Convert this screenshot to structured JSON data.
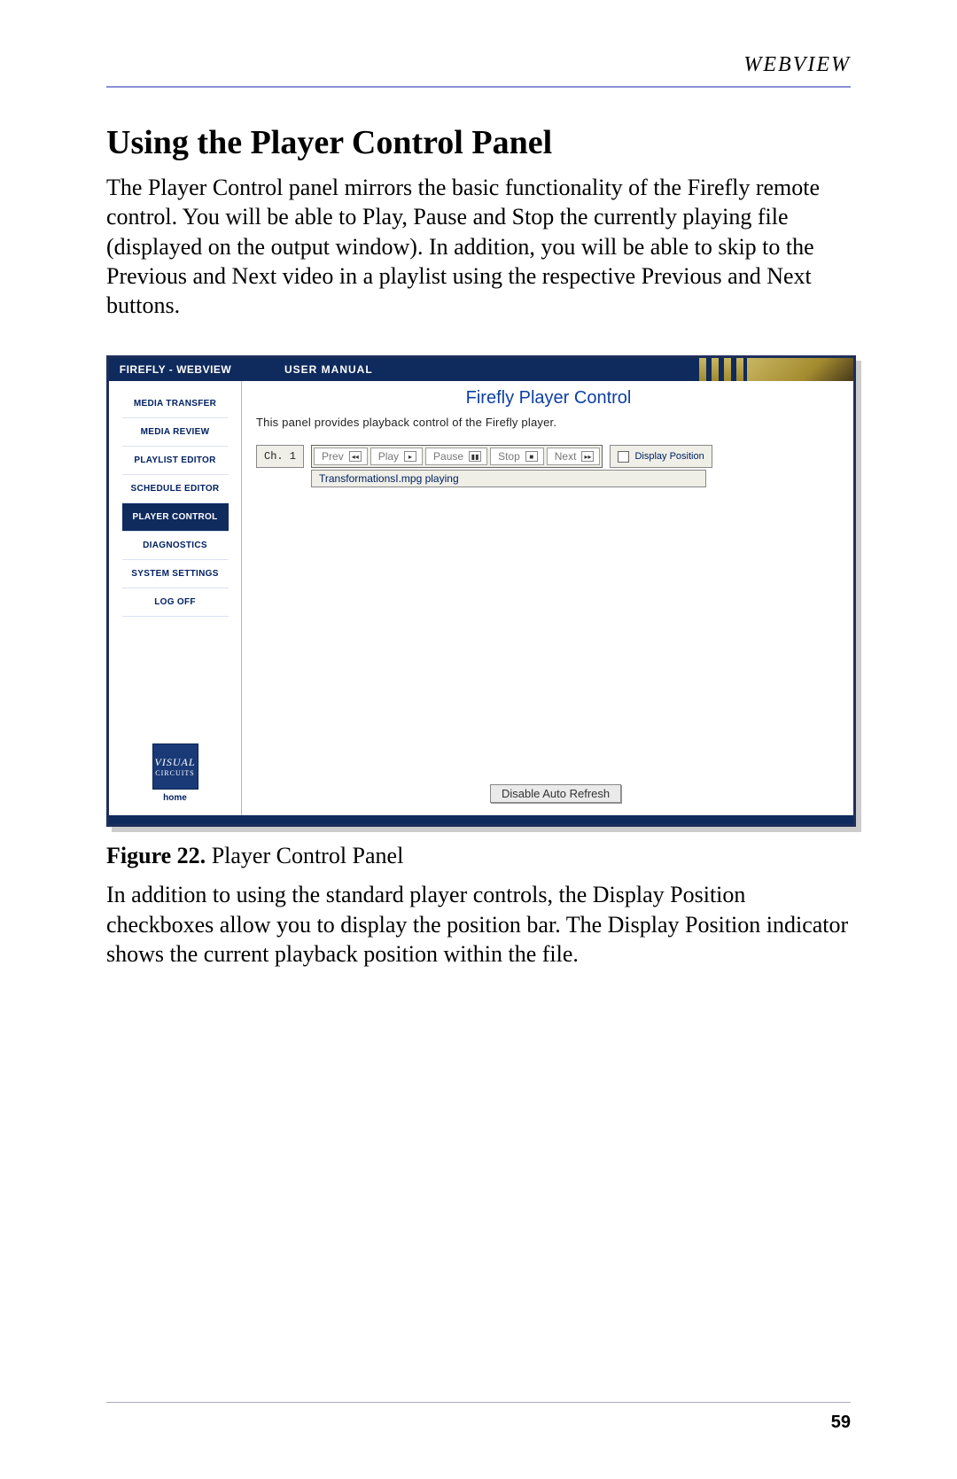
{
  "running_head": "WEBVIEW",
  "heading": "Using the Player Control Panel",
  "para1": "The Player Control panel mirrors the basic functionality of the Firefly remote control. You will be able to Play, Pause and Stop the currently playing file (displayed on the output window). In addition, you will be able to skip to the Previous and Next video in a playlist using the respective Previous and Next buttons.",
  "para2": "In addition to using the standard player controls, the Display Position checkboxes allow you to display the position bar. The Display Position indicator shows the current playback position within the file.",
  "caption": {
    "bold": "Figure 22.",
    "rest": "  Player Control Panel"
  },
  "shot": {
    "header_left": "FIREFLY - WEBVIEW",
    "header_mid": "USER MANUAL",
    "sidebar": {
      "items": [
        "MEDIA TRANSFER",
        "MEDIA REVIEW",
        "PLAYLIST EDITOR",
        "SCHEDULE EDITOR",
        "PLAYER CONTROL",
        "DIAGNOSTICS",
        "SYSTEM SETTINGS",
        "LOG OFF"
      ],
      "active_index": 4,
      "logo_top": "VISUAL",
      "logo_bottom": "CIRCUITS",
      "home": "home"
    },
    "main": {
      "title": "Firefly Player Control",
      "desc": "This panel provides playback control of the Firefly player.",
      "channel": "Ch. 1",
      "buttons": {
        "prev": "Prev",
        "play": "Play",
        "pause": "Pause",
        "stop": "Stop",
        "next": "Next"
      },
      "display_position": "Display Position",
      "status": "TransformationsI.mpg playing",
      "refresh": "Disable Auto Refresh"
    }
  },
  "page_number": "59"
}
